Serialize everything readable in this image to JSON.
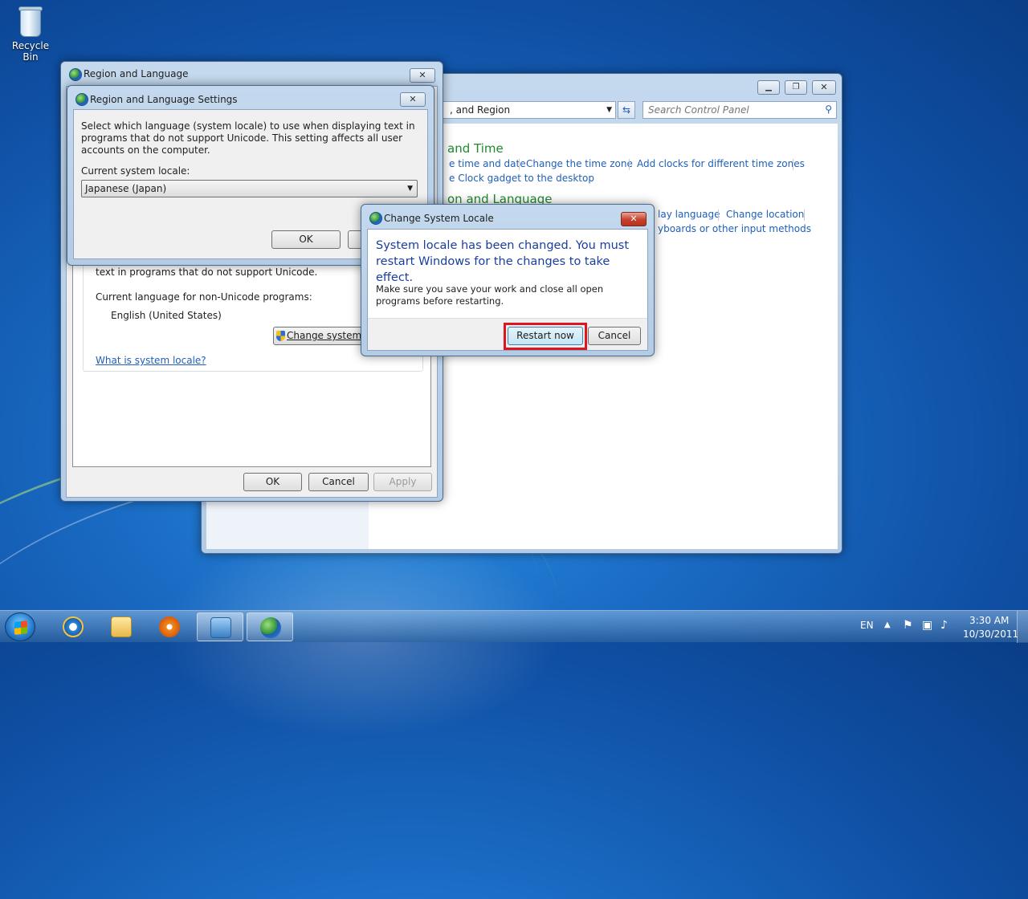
{
  "desktop": {
    "recycle_bin_label": "Recycle Bin"
  },
  "control_panel": {
    "address_tail": ", and Region",
    "search_placeholder": "Search Control Panel",
    "section1_heading": "and Time",
    "section1_links": [
      "e time and date",
      "Change the time zone",
      "Add clocks for different time zones"
    ],
    "section1_link2": "e Clock gadget to the desktop",
    "section2_heading": "on and Language",
    "section2_links": [
      "lay language",
      "Change location"
    ],
    "section2_link2": "yboards or other input methods"
  },
  "region_dialog": {
    "title": "Region and Language",
    "partial_text": "text in programs that do not support Unicode.",
    "current_lang_label": "Current language for non-Unicode programs:",
    "current_lang_value": "English (United States)",
    "change_button": "Change system",
    "what_link": "What is system locale?",
    "ok": "OK",
    "cancel": "Cancel",
    "apply": "Apply"
  },
  "settings_dialog": {
    "title": "Region and Language Settings",
    "description": "Select which language (system locale) to use when displaying text in programs that do not support Unicode. This setting affects all user accounts on the computer.",
    "locale_label": "Current system locale:",
    "locale_value": "Japanese (Japan)",
    "ok": "OK"
  },
  "locale_dialog": {
    "title": "Change System Locale",
    "main_message": "System locale has been changed. You must restart Windows for the changes to take effect.",
    "sub_message": "Make sure you save your work and close all open programs before restarting.",
    "restart": "Restart now",
    "cancel": "Cancel"
  },
  "taskbar": {
    "language": "EN",
    "time": "3:30 AM",
    "date": "10/30/2011"
  },
  "colors": {
    "link": "#1f5fb8",
    "heading_green": "#1e8a2e",
    "dialog_heading_blue": "#1a3e9c",
    "highlight_red": "#e0141e"
  }
}
